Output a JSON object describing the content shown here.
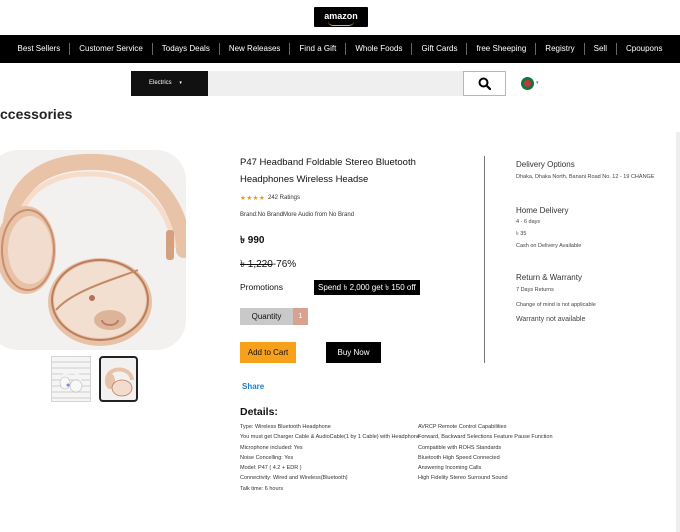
{
  "header": {
    "logo_text": "amazon"
  },
  "nav": {
    "items": [
      "Best  Sellers",
      "Customer Service",
      "Todays Deals",
      "New Releases",
      "Find a Gift",
      "Whole Foods",
      "Gift Cards",
      "free Sheeping",
      "Registry",
      "Sell",
      "Cpoupons"
    ]
  },
  "search": {
    "category": "Electrics",
    "caret": "▾",
    "value": "",
    "placeholder": ""
  },
  "breadcrumb": "ccessories",
  "product": {
    "title": "P47 Headband Foldable Stereo Bluetooth Headphones Wireless Headse",
    "stars": "★★★★",
    "rating_value": 4,
    "ratings_text": "242 Ratings",
    "brand_text": "Brand:No BrandMore Audio from No Brand",
    "price": "৳ 990",
    "old_price": "৳ 1,220",
    "discount": "-76%",
    "promotions_label": "Promotions",
    "promo_badge": "Spend ৳ 2,000 get ৳ 150 off",
    "quantity_label": "Quantity",
    "quantity_value": "1",
    "add_to_cart": "Add to Cart",
    "buy_now": "Buy Now",
    "share": "Share"
  },
  "delivery": {
    "options_title": "Delivery Options",
    "address": "Dhaka, Dhaka North, Banani Road No. 12 - 19 CHANGE",
    "home_delivery_title": "Home Delivery",
    "days": "4 - 6 days",
    "fee": "৳ 35",
    "cod": "Cash on Delivery Available",
    "return_title": "Return & Warranty",
    "returns": "7 Days Returns",
    "change_mind": "Change of mind is not applicable",
    "warranty": "Warranty not available"
  },
  "details": {
    "title": "Details:",
    "left": [
      "Type: Wireless Bluetooth Headphone",
      "You must get Charger Cable & AudioCable(1 by 1 Cable) with Headphone",
      "Microphone included: Yes",
      "Noise Concelling: Yes",
      "Model: P47 ( 4.2 + EDR )",
      "Connectivity: Wired and Wireless(Bluetooth)",
      "Talk time: 6 hours"
    ],
    "right": [
      "AVRCP Remote Control Capabilities",
      "Forward, Backward Selections Feature Pause Function",
      "Compatible with ROHS Standards",
      "Bluetooth High Speed Connected",
      "Answering Incoming Calls",
      "High Fidelity Stereo Surround Sound"
    ]
  },
  "colors": {
    "nav_bg": "#000000",
    "cart_button": "#f7a01c",
    "buy_button": "#000000",
    "share_link": "#1f7fc6",
    "qty_accent": "#d9a18f",
    "star": "#e89a0e"
  }
}
